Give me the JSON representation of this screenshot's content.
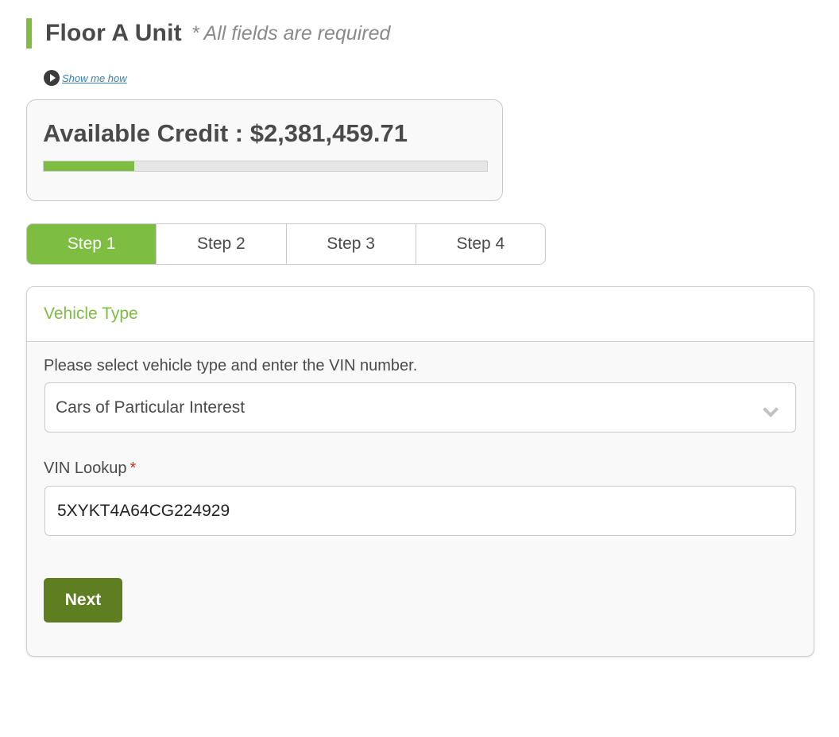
{
  "header": {
    "title": "Floor A Unit",
    "required_note": "* All fields are required"
  },
  "help": {
    "show_me_how": "Show me how",
    "icon": "play-circle-icon"
  },
  "credit": {
    "label": "Available Credit : $2,381,459.71",
    "usage_fraction": 0.205,
    "bar_color": "#7cbd42"
  },
  "steps": {
    "items": [
      {
        "label": "Step 1",
        "active": true
      },
      {
        "label": "Step 2",
        "active": false
      },
      {
        "label": "Step 3",
        "active": false
      },
      {
        "label": "Step 4",
        "active": false
      }
    ],
    "active_color": "#7cbd42"
  },
  "panel": {
    "title": "Vehicle Type",
    "instructions": "Please select vehicle type and enter the VIN number.",
    "vehicle_select": {
      "selected": "Cars of Particular Interest",
      "icon": "chevron-down-icon"
    },
    "vin": {
      "label": "VIN Lookup",
      "required_mark": "*",
      "value": "5XYKT4A64CG224929"
    },
    "next_label": "Next"
  },
  "colors": {
    "accent": "#7cbd42",
    "button": "#5e7e21",
    "required": "#c0392b"
  }
}
